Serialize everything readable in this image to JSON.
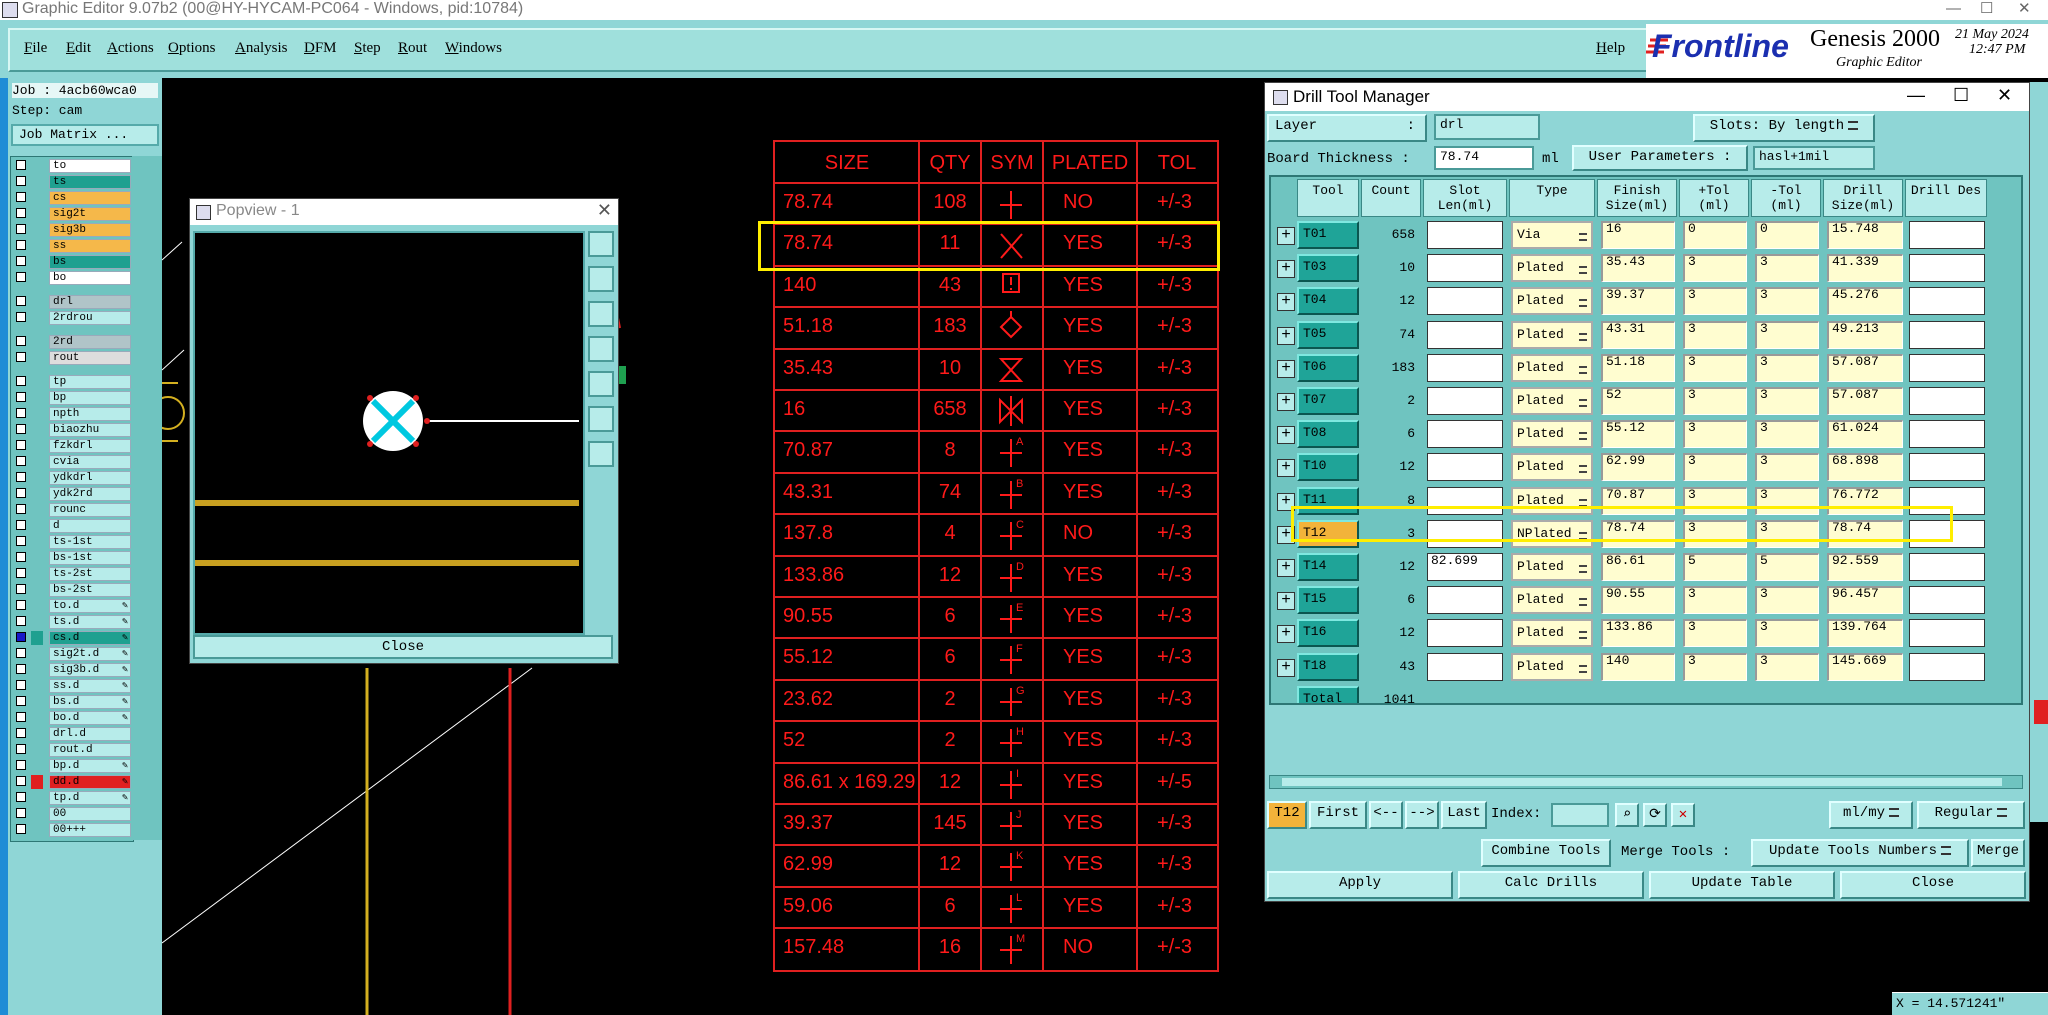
{
  "window": {
    "title": "Graphic Editor 9.07b2 (00@HY-HYCAM-PC064 - Windows, pid:10784)"
  },
  "menu": {
    "items": [
      "File",
      "Edit",
      "Actions",
      "Options",
      "Analysis",
      "DFM",
      "Step",
      "Rout",
      "Windows"
    ],
    "help": "Help"
  },
  "brand": {
    "logo": "Frontline",
    "product": "Genesis 2000",
    "subtitle": "Graphic Editor",
    "date": "21 May 2024",
    "time": "12:47 PM"
  },
  "job": {
    "job_label": "Job : 4acb60wca0",
    "step_label": "Step: cam",
    "matrix_button": "Job Matrix ..."
  },
  "layers": [
    {
      "name": "to",
      "color": "#ffffff",
      "checked": false
    },
    {
      "name": "ts",
      "color": "#1fa090",
      "checked": false
    },
    {
      "name": "cs",
      "color": "#f5b84a",
      "checked": false
    },
    {
      "name": "sig2t",
      "color": "#f5b84a",
      "checked": false
    },
    {
      "name": "sig3b",
      "color": "#f5b84a",
      "checked": false
    },
    {
      "name": "ss",
      "color": "#f5b84a",
      "checked": false
    },
    {
      "name": "bs",
      "color": "#1fa090",
      "checked": false
    },
    {
      "name": "bo",
      "color": "#ffffff",
      "checked": false
    },
    {
      "name": "drl",
      "color": "#b0c4c8",
      "checked": false
    },
    {
      "name": "2rdrou",
      "color": "#b7ecea",
      "checked": false
    },
    {
      "name": "2rd",
      "color": "#b0c4c8",
      "checked": false
    },
    {
      "name": "rout",
      "color": "#dddddd",
      "checked": false
    },
    {
      "name": "tp",
      "color": "#b7ecea",
      "checked": false
    },
    {
      "name": "bp",
      "color": "#b7ecea",
      "checked": false
    },
    {
      "name": "npth",
      "color": "#b7ecea",
      "checked": false
    },
    {
      "name": "biaozhu",
      "color": "#b7ecea",
      "checked": false
    },
    {
      "name": "fzkdrl",
      "color": "#b7ecea",
      "checked": false
    },
    {
      "name": "cvia",
      "color": "#b7ecea",
      "checked": false
    },
    {
      "name": "ydkdrl",
      "color": "#b7ecea",
      "checked": false
    },
    {
      "name": "ydk2rd",
      "color": "#b7ecea",
      "checked": false
    },
    {
      "name": "rounc",
      "color": "#b7ecea",
      "checked": false
    },
    {
      "name": "d",
      "color": "#b7ecea",
      "checked": false
    },
    {
      "name": "ts-1st",
      "color": "#b7ecea",
      "checked": false
    },
    {
      "name": "bs-1st",
      "color": "#b7ecea",
      "checked": false
    },
    {
      "name": "ts-2st",
      "color": "#b7ecea",
      "checked": false
    },
    {
      "name": "bs-2st",
      "color": "#b7ecea",
      "checked": false
    },
    {
      "name": "to.d",
      "color": "#b7ecea",
      "checked": false,
      "pen": true
    },
    {
      "name": "ts.d",
      "color": "#b7ecea",
      "checked": false,
      "pen": true
    },
    {
      "name": "cs.d",
      "color": "#1fa090",
      "checked": true,
      "pen": true
    },
    {
      "name": "sig2t.d",
      "color": "#b7ecea",
      "checked": false,
      "pen": true
    },
    {
      "name": "sig3b.d",
      "color": "#b7ecea",
      "checked": false,
      "pen": true
    },
    {
      "name": "ss.d",
      "color": "#b7ecea",
      "checked": false,
      "pen": true
    },
    {
      "name": "bs.d",
      "color": "#b7ecea",
      "checked": false,
      "pen": true
    },
    {
      "name": "bo.d",
      "color": "#b7ecea",
      "checked": false,
      "pen": true
    },
    {
      "name": "drl.d",
      "color": "#b7ecea",
      "checked": false
    },
    {
      "name": "rout.d",
      "color": "#b7ecea",
      "checked": false
    },
    {
      "name": "bp.d",
      "color": "#b7ecea",
      "checked": false,
      "pen": true
    },
    {
      "name": "dd.d",
      "color": "#e02020",
      "checked": false,
      "pen": true
    },
    {
      "name": "tp.d",
      "color": "#b7ecea",
      "checked": false,
      "pen": true
    },
    {
      "name": "00",
      "color": "#b7ecea",
      "checked": false
    },
    {
      "name": "00+++",
      "color": "#b7ecea",
      "checked": false
    }
  ],
  "popview": {
    "title": "Popview - 1",
    "close_label": "Close"
  },
  "drill_table": {
    "headers": [
      "SIZE",
      "QTY",
      "SYM",
      "PLATED",
      "TOL"
    ],
    "rows": [
      {
        "size": "78.74",
        "qty": "108",
        "sym": "plus",
        "sym_letter": "",
        "plated": "NO",
        "tol": "+/-3"
      },
      {
        "size": "78.74",
        "qty": "11",
        "sym": "x",
        "sym_letter": "",
        "plated": "YES",
        "tol": "+/-3"
      },
      {
        "size": "140",
        "qty": "43",
        "sym": "box-bang",
        "sym_letter": "",
        "plated": "YES",
        "tol": "+/-3"
      },
      {
        "size": "51.18",
        "qty": "183",
        "sym": "diamond",
        "sym_letter": "",
        "plated": "YES",
        "tol": "+/-3"
      },
      {
        "size": "35.43",
        "qty": "10",
        "sym": "hourglass",
        "sym_letter": "",
        "plated": "YES",
        "tol": "+/-3"
      },
      {
        "size": "16",
        "qty": "658",
        "sym": "bowtie",
        "sym_letter": "",
        "plated": "YES",
        "tol": "+/-3"
      },
      {
        "size": "70.87",
        "qty": "8",
        "sym": "plus-letter",
        "sym_letter": "A",
        "plated": "YES",
        "tol": "+/-3"
      },
      {
        "size": "43.31",
        "qty": "74",
        "sym": "plus-letter",
        "sym_letter": "B",
        "plated": "YES",
        "tol": "+/-3"
      },
      {
        "size": "137.8",
        "qty": "4",
        "sym": "plus-letter",
        "sym_letter": "C",
        "plated": "NO",
        "tol": "+/-3"
      },
      {
        "size": "133.86",
        "qty": "12",
        "sym": "plus-letter",
        "sym_letter": "D",
        "plated": "YES",
        "tol": "+/-3"
      },
      {
        "size": "90.55",
        "qty": "6",
        "sym": "plus-letter",
        "sym_letter": "E",
        "plated": "YES",
        "tol": "+/-3"
      },
      {
        "size": "55.12",
        "qty": "6",
        "sym": "plus-letter",
        "sym_letter": "F",
        "plated": "YES",
        "tol": "+/-3"
      },
      {
        "size": "23.62",
        "qty": "2",
        "sym": "plus-letter",
        "sym_letter": "G",
        "plated": "YES",
        "tol": "+/-3"
      },
      {
        "size": "52",
        "qty": "2",
        "sym": "plus-letter",
        "sym_letter": "H",
        "plated": "YES",
        "tol": "+/-3"
      },
      {
        "size": "86.61 x 169.29",
        "qty": "12",
        "sym": "plus-letter",
        "sym_letter": "I",
        "plated": "YES",
        "tol": "+/-5"
      },
      {
        "size": "39.37",
        "qty": "145",
        "sym": "plus-letter",
        "sym_letter": "J",
        "plated": "YES",
        "tol": "+/-3"
      },
      {
        "size": "62.99",
        "qty": "12",
        "sym": "plus-letter",
        "sym_letter": "K",
        "plated": "YES",
        "tol": "+/-3"
      },
      {
        "size": "59.06",
        "qty": "6",
        "sym": "plus-letter",
        "sym_letter": "L",
        "plated": "YES",
        "tol": "+/-3"
      },
      {
        "size": "157.48",
        "qty": "16",
        "sym": "plus-letter",
        "sym_letter": "M",
        "plated": "NO",
        "tol": "+/-3"
      }
    ]
  },
  "dtm": {
    "title": "Drill Tool Manager",
    "layer_label": "Layer",
    "layer_value": "drl",
    "slots_label": "Slots: By length",
    "board_thickness_label": "Board Thickness :",
    "board_thickness_value": "78.74",
    "board_thickness_unit": "ml",
    "user_params_label": "User Parameters :",
    "user_params_value": "hasl+1mil",
    "columns": [
      "Tool",
      "Count",
      "Slot Len(ml)",
      "Type",
      "Finish Size(ml)",
      "+Tol (ml)",
      "-Tol (ml)",
      "Drill Size(ml)",
      "Drill Des"
    ],
    "rows": [
      {
        "tool": "T01",
        "count": "658",
        "slot": "",
        "type": "Via",
        "finish": "16",
        "ptol": "0",
        "mtol": "0",
        "drill": "15.748",
        "selected": false
      },
      {
        "tool": "T03",
        "count": "10",
        "slot": "",
        "type": "Plated",
        "finish": "35.43",
        "ptol": "3",
        "mtol": "3",
        "drill": "41.339",
        "selected": false
      },
      {
        "tool": "T04",
        "count": "12",
        "slot": "",
        "type": "Plated",
        "finish": "39.37",
        "ptol": "3",
        "mtol": "3",
        "drill": "45.276",
        "selected": false
      },
      {
        "tool": "T05",
        "count": "74",
        "slot": "",
        "type": "Plated",
        "finish": "43.31",
        "ptol": "3",
        "mtol": "3",
        "drill": "49.213",
        "selected": false
      },
      {
        "tool": "T06",
        "count": "183",
        "slot": "",
        "type": "Plated",
        "finish": "51.18",
        "ptol": "3",
        "mtol": "3",
        "drill": "57.087",
        "selected": false
      },
      {
        "tool": "T07",
        "count": "2",
        "slot": "",
        "type": "Plated",
        "finish": "52",
        "ptol": "3",
        "mtol": "3",
        "drill": "57.087",
        "selected": false
      },
      {
        "tool": "T08",
        "count": "6",
        "slot": "",
        "type": "Plated",
        "finish": "55.12",
        "ptol": "3",
        "mtol": "3",
        "drill": "61.024",
        "selected": false
      },
      {
        "tool": "T10",
        "count": "12",
        "slot": "",
        "type": "Plated",
        "finish": "62.99",
        "ptol": "3",
        "mtol": "3",
        "drill": "68.898",
        "selected": false
      },
      {
        "tool": "T11",
        "count": "8",
        "slot": "",
        "type": "Plated",
        "finish": "70.87",
        "ptol": "3",
        "mtol": "3",
        "drill": "76.772",
        "selected": false
      },
      {
        "tool": "T12",
        "count": "3",
        "slot": "",
        "type": "NPlated",
        "finish": "78.74",
        "ptol": "3",
        "mtol": "3",
        "drill": "78.74",
        "selected": true
      },
      {
        "tool": "T14",
        "count": "12",
        "slot": "82.699",
        "type": "Plated",
        "finish": "86.61",
        "ptol": "5",
        "mtol": "5",
        "drill": "92.559",
        "selected": false
      },
      {
        "tool": "T15",
        "count": "6",
        "slot": "",
        "type": "Plated",
        "finish": "90.55",
        "ptol": "3",
        "mtol": "3",
        "drill": "96.457",
        "selected": false
      },
      {
        "tool": "T16",
        "count": "12",
        "slot": "",
        "type": "Plated",
        "finish": "133.86",
        "ptol": "3",
        "mtol": "3",
        "drill": "139.764",
        "selected": false
      },
      {
        "tool": "T18",
        "count": "43",
        "slot": "",
        "type": "Plated",
        "finish": "140",
        "ptol": "3",
        "mtol": "3",
        "drill": "145.669",
        "selected": false
      }
    ],
    "total_label": "Total",
    "total_count": "1041",
    "nav": {
      "current": "T12",
      "first": "First",
      "prev": "<--",
      "next": "-->",
      "last": "Last",
      "index_label": "Index:",
      "unit": "ml/my",
      "mode": "Regular"
    },
    "actions": {
      "combine": "Combine Tools",
      "merge_label": "Merge Tools :",
      "update_numbers": "Update Tools Numbers",
      "merge": "Merge",
      "apply": "Apply",
      "calc": "Calc Drills",
      "update_table": "Update Table",
      "close": "Close"
    }
  },
  "status": {
    "coord": "X = 14.571241\""
  }
}
